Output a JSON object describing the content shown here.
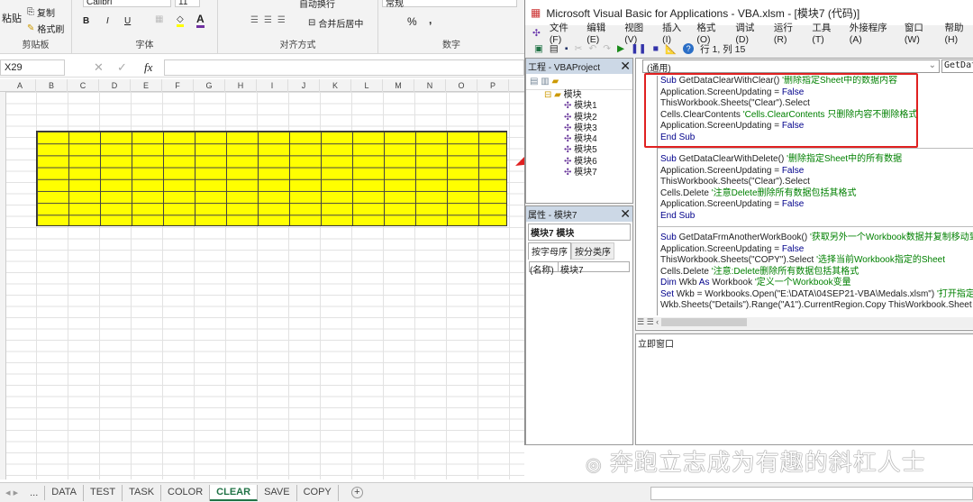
{
  "ribbon": {
    "clipboard": {
      "paste": "粘贴",
      "copy": "复制",
      "format_painter": "格式刷",
      "label": "剪贴板"
    },
    "font": {
      "name": "Calibri",
      "size": "11",
      "bold": "B",
      "italic": "I",
      "underline": "U",
      "label": "字体"
    },
    "alignment": {
      "wrap": "自动换行",
      "merge": "合并后居中",
      "label": "对齐方式"
    },
    "number": {
      "format": "常规",
      "percent": "%",
      "comma": ",",
      "label": "数字"
    }
  },
  "formula_bar": {
    "name_box": "X29",
    "fx": "fx",
    "cancel": "✕",
    "enter": "✓"
  },
  "columns": [
    "A",
    "B",
    "C",
    "D",
    "E",
    "F",
    "G",
    "H",
    "I",
    "J",
    "K",
    "L",
    "M",
    "N",
    "O",
    "P"
  ],
  "sheet_tabs": {
    "more": "...",
    "tabs": [
      "DATA",
      "TEST",
      "TASK",
      "COLOR",
      "CLEAR",
      "SAVE",
      "COPY"
    ],
    "active": "CLEAR",
    "add": "+"
  },
  "vba": {
    "title": "Microsoft Visual Basic for Applications - VBA.xlsm - [模块7 (代码)]",
    "menu": [
      "文件(F)",
      "编辑(E)",
      "视图(V)",
      "插入(I)",
      "格式(O)",
      "调试(D)",
      "运行(R)",
      "工具(T)",
      "外接程序(A)",
      "窗口(W)",
      "帮助(H)"
    ],
    "cursor_pos": "行 1, 列 15",
    "project": {
      "title": "工程 - VBAProject",
      "folder": "模块",
      "modules": [
        "模块1",
        "模块2",
        "模块3",
        "模块4",
        "模块5",
        "模块6",
        "模块7"
      ]
    },
    "properties": {
      "title": "属性 - 模块7",
      "object": "模块7 模块",
      "tab_alpha": "按字母序",
      "tab_cat": "按分类序",
      "name_key": "(名称)",
      "name_val": "模块7"
    },
    "object_combo": "(通用)",
    "proc_combo": "GetDataClearWithClear",
    "code": [
      [
        [
          "kw",
          "Sub "
        ],
        [
          "",
          "GetDataClearWithClear() "
        ],
        [
          "cm",
          "'删除指定Sheet中的数据内容"
        ]
      ],
      [
        [
          "",
          "Application.ScreenUpdating = "
        ],
        [
          "kw",
          "False"
        ]
      ],
      [
        [
          "",
          "ThisWorkbook.Sheets(\"Clear\").Select"
        ]
      ],
      [
        [
          "",
          "Cells.ClearContents "
        ],
        [
          "cm",
          "'Cells.ClearContents 只删除内容不删除格式"
        ]
      ],
      [
        [
          "",
          "Application.ScreenUpdating = "
        ],
        [
          "kw",
          "False"
        ]
      ],
      [
        [
          "kw",
          "End Sub"
        ]
      ],
      "sep",
      [
        [
          "kw",
          "Sub "
        ],
        [
          "",
          "GetDataClearWithDelete() "
        ],
        [
          "cm",
          "'删除指定Sheet中的所有数据"
        ]
      ],
      [
        [
          "",
          "Application.ScreenUpdating = "
        ],
        [
          "kw",
          "False"
        ]
      ],
      [
        [
          "",
          "ThisWorkbook.Sheets(\"Clear\").Select"
        ]
      ],
      [
        [
          "",
          "Cells.Delete "
        ],
        [
          "cm",
          "'注意Delete删除所有数据包括其格式"
        ]
      ],
      [
        [
          "",
          "Application.ScreenUpdating = "
        ],
        [
          "kw",
          "False"
        ]
      ],
      [
        [
          "kw",
          "End Sub"
        ]
      ],
      "sep",
      [
        [
          "kw",
          "Sub "
        ],
        [
          "",
          "GetDataFrmAnotherWorkBook() "
        ],
        [
          "cm",
          "'获取另外一个Workbook数据并复制移动到"
        ]
      ],
      [
        [
          "",
          "Application.ScreenUpdating = "
        ],
        [
          "kw",
          "False"
        ]
      ],
      [
        [
          "",
          "ThisWorkbook.Sheets(\"COPY\").Select "
        ],
        [
          "cm",
          "'选择当前Workbook指定的Sheet"
        ]
      ],
      [
        [
          "",
          "Cells.Delete "
        ],
        [
          "cm",
          "'注意:Delete删除所有数据包括其格式"
        ]
      ],
      [
        [
          "kw",
          "Dim "
        ],
        [
          "",
          "Wkb "
        ],
        [
          "kw",
          "As "
        ],
        [
          "",
          "Workbook "
        ],
        [
          "cm",
          "'定义一个Workbook变量"
        ]
      ],
      [
        [
          "kw",
          "Set "
        ],
        [
          "",
          "Wkb = Workbooks.Open(\"E:\\DATA\\04SEP21-VBA\\Medals.xlsm\") "
        ],
        [
          "cm",
          "'打开指定"
        ]
      ],
      [
        [
          "",
          "Wkb.Sheets(\"Details\").Range(\"A1\").CurrentRegion.Copy ThisWorkbook.Sheet"
        ]
      ]
    ],
    "immediate_title": "立即窗口"
  },
  "watermark": "奔跑立志成为有趣的斜杠人士",
  "colors": {
    "highlight": "#e02020",
    "cell_fill": "#ffff00",
    "active_tab": "#217346"
  }
}
